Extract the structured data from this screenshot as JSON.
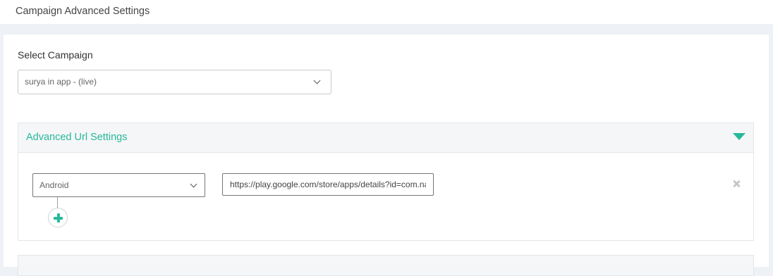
{
  "header": {
    "title": "Campaign Advanced Settings"
  },
  "campaign": {
    "label": "Select Campaign",
    "selected": "surya in app - (live)"
  },
  "advanced_url": {
    "title": "Advanced Url Settings",
    "expanded": true,
    "accent_color": "#26b99a",
    "rows": [
      {
        "platform": "Android",
        "url": "https://play.google.com/store/apps/details?id=com.na"
      }
    ]
  },
  "icons": {
    "collapse": "triangle-down-icon",
    "add": "plus-icon",
    "remove": "close-icon",
    "dropdown": "chevron-down-icon"
  }
}
